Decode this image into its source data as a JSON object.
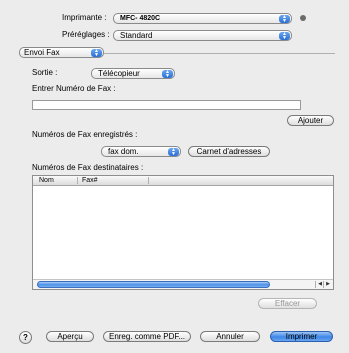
{
  "printer": {
    "label": "Imprimante :",
    "value": "MFC- 4820C"
  },
  "presets": {
    "label": "Préréglages :",
    "value": "Standard"
  },
  "panel": {
    "value": "Envoi Fax"
  },
  "output": {
    "label": "Sortie :",
    "value": "Télécopieur"
  },
  "fax_entry": {
    "label": "Entrer Numéro de Fax :",
    "value": "",
    "add_button": "Ajouter"
  },
  "saved": {
    "label": "Numéros de Fax enregistrés :",
    "value": "fax dom.",
    "address_book_button": "Carnet d'adresses"
  },
  "recipients": {
    "label": "Numéros de Fax destinataires :",
    "columns": [
      "Nom",
      "Fax#"
    ],
    "rows": []
  },
  "delete_button": "Effacer",
  "footer": {
    "help": "?",
    "preview": "Aperçu",
    "save_pdf": "Enreg. comme PDF...",
    "cancel": "Annuler",
    "print": "Imprimer"
  }
}
